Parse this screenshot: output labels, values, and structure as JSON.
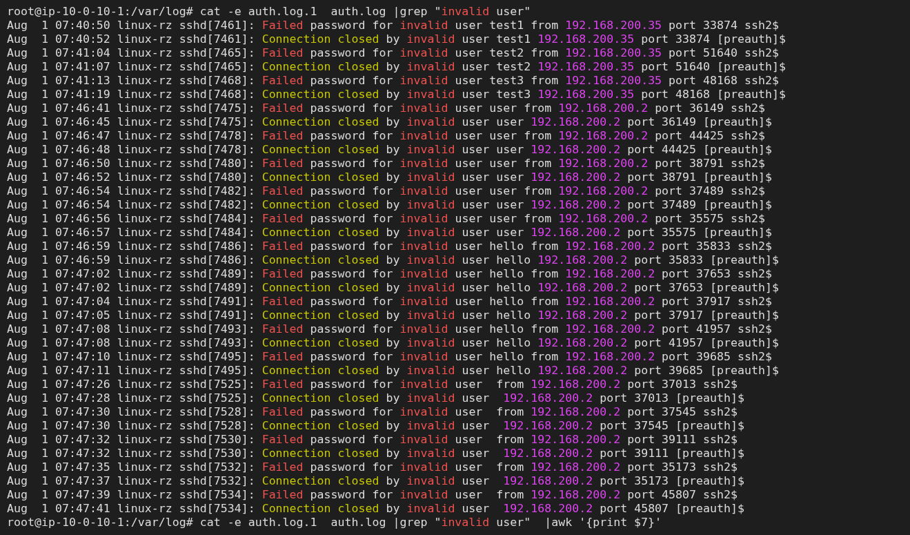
{
  "terminal": {
    "lines": [
      {
        "segments": [
          {
            "text": "root@ip-10-0-10-1:/var/log# cat -e auth.log.1  auth.log |grep \"",
            "kind": "plain"
          },
          {
            "text": "invalid",
            "kind": "error"
          },
          {
            "text": " user\"",
            "kind": "plain"
          }
        ]
      },
      {
        "segments": [
          {
            "text": "Aug  1 07:40:50 linux-rz sshd[7461]: ",
            "kind": "plain"
          },
          {
            "text": "Failed",
            "kind": "error"
          },
          {
            "text": " password for ",
            "kind": "plain"
          },
          {
            "text": "invalid",
            "kind": "error"
          },
          {
            "text": " user test1 from ",
            "kind": "plain"
          },
          {
            "text": "192.168.200.35",
            "kind": "ip"
          },
          {
            "text": " port 33874 ssh2$",
            "kind": "plain"
          }
        ]
      },
      {
        "segments": [
          {
            "text": "Aug  1 07:40:52 linux-rz sshd[7461]: ",
            "kind": "plain"
          },
          {
            "text": "Connection closed",
            "kind": "ok"
          },
          {
            "text": " by ",
            "kind": "plain"
          },
          {
            "text": "invalid",
            "kind": "error"
          },
          {
            "text": " user test1 ",
            "kind": "plain"
          },
          {
            "text": "192.168.200.35",
            "kind": "ip"
          },
          {
            "text": " port 33874 [preauth]$",
            "kind": "plain"
          }
        ]
      },
      {
        "segments": [
          {
            "text": "Aug  1 07:41:04 linux-rz sshd[7465]: ",
            "kind": "plain"
          },
          {
            "text": "Failed",
            "kind": "error"
          },
          {
            "text": " password for ",
            "kind": "plain"
          },
          {
            "text": "invalid",
            "kind": "error"
          },
          {
            "text": " user test2 from ",
            "kind": "plain"
          },
          {
            "text": "192.168.200.35",
            "kind": "ip"
          },
          {
            "text": " port 51640 ssh2$",
            "kind": "plain"
          }
        ]
      },
      {
        "segments": [
          {
            "text": "Aug  1 07:41:07 linux-rz sshd[7465]: ",
            "kind": "plain"
          },
          {
            "text": "Connection closed",
            "kind": "ok"
          },
          {
            "text": " by ",
            "kind": "plain"
          },
          {
            "text": "invalid",
            "kind": "error"
          },
          {
            "text": " user test2 ",
            "kind": "plain"
          },
          {
            "text": "192.168.200.35",
            "kind": "ip"
          },
          {
            "text": " port 51640 [preauth]$",
            "kind": "plain"
          }
        ]
      },
      {
        "segments": [
          {
            "text": "Aug  1 07:41:13 linux-rz sshd[7468]: ",
            "kind": "plain"
          },
          {
            "text": "Failed",
            "kind": "error"
          },
          {
            "text": " password for ",
            "kind": "plain"
          },
          {
            "text": "invalid",
            "kind": "error"
          },
          {
            "text": " user test3 from ",
            "kind": "plain"
          },
          {
            "text": "192.168.200.35",
            "kind": "ip"
          },
          {
            "text": " port 48168 ssh2$",
            "kind": "plain"
          }
        ]
      },
      {
        "segments": [
          {
            "text": "Aug  1 07:41:19 linux-rz sshd[7468]: ",
            "kind": "plain"
          },
          {
            "text": "Connection closed",
            "kind": "ok"
          },
          {
            "text": " by ",
            "kind": "plain"
          },
          {
            "text": "invalid",
            "kind": "error"
          },
          {
            "text": " user test3 ",
            "kind": "plain"
          },
          {
            "text": "192.168.200.35",
            "kind": "ip"
          },
          {
            "text": " port 48168 [preauth]$",
            "kind": "plain"
          }
        ]
      },
      {
        "segments": [
          {
            "text": "Aug  1 07:46:41 linux-rz sshd[7475]: ",
            "kind": "plain"
          },
          {
            "text": "Failed",
            "kind": "error"
          },
          {
            "text": " password for ",
            "kind": "plain"
          },
          {
            "text": "invalid",
            "kind": "error"
          },
          {
            "text": " user user from ",
            "kind": "plain"
          },
          {
            "text": "192.168.200.2",
            "kind": "ip"
          },
          {
            "text": " port 36149 ssh2$",
            "kind": "plain"
          }
        ]
      },
      {
        "segments": [
          {
            "text": "Aug  1 07:46:45 linux-rz sshd[7475]: ",
            "kind": "plain"
          },
          {
            "text": "Connection closed",
            "kind": "ok"
          },
          {
            "text": " by ",
            "kind": "plain"
          },
          {
            "text": "invalid",
            "kind": "error"
          },
          {
            "text": " user user ",
            "kind": "plain"
          },
          {
            "text": "192.168.200.2",
            "kind": "ip"
          },
          {
            "text": " port 36149 [preauth]$",
            "kind": "plain"
          }
        ]
      },
      {
        "segments": [
          {
            "text": "Aug  1 07:46:47 linux-rz sshd[7478]: ",
            "kind": "plain"
          },
          {
            "text": "Failed",
            "kind": "error"
          },
          {
            "text": " password for ",
            "kind": "plain"
          },
          {
            "text": "invalid",
            "kind": "error"
          },
          {
            "text": " user user from ",
            "kind": "plain"
          },
          {
            "text": "192.168.200.2",
            "kind": "ip"
          },
          {
            "text": " port 44425 ssh2$",
            "kind": "plain"
          }
        ]
      },
      {
        "segments": [
          {
            "text": "Aug  1 07:46:48 linux-rz sshd[7478]: ",
            "kind": "plain"
          },
          {
            "text": "Connection closed",
            "kind": "ok"
          },
          {
            "text": " by ",
            "kind": "plain"
          },
          {
            "text": "invalid",
            "kind": "error"
          },
          {
            "text": " user user ",
            "kind": "plain"
          },
          {
            "text": "192.168.200.2",
            "kind": "ip"
          },
          {
            "text": " port 44425 [preauth]$",
            "kind": "plain"
          }
        ]
      },
      {
        "segments": [
          {
            "text": "Aug  1 07:46:50 linux-rz sshd[7480]: ",
            "kind": "plain"
          },
          {
            "text": "Failed",
            "kind": "error"
          },
          {
            "text": " password for ",
            "kind": "plain"
          },
          {
            "text": "invalid",
            "kind": "error"
          },
          {
            "text": " user user from ",
            "kind": "plain"
          },
          {
            "text": "192.168.200.2",
            "kind": "ip"
          },
          {
            "text": " port 38791 ssh2$",
            "kind": "plain"
          }
        ]
      },
      {
        "segments": [
          {
            "text": "Aug  1 07:46:52 linux-rz sshd[7480]: ",
            "kind": "plain"
          },
          {
            "text": "Connection closed",
            "kind": "ok"
          },
          {
            "text": " by ",
            "kind": "plain"
          },
          {
            "text": "invalid",
            "kind": "error"
          },
          {
            "text": " user user ",
            "kind": "plain"
          },
          {
            "text": "192.168.200.2",
            "kind": "ip"
          },
          {
            "text": " port 38791 [preauth]$",
            "kind": "plain"
          }
        ]
      },
      {
        "segments": [
          {
            "text": "Aug  1 07:46:54 linux-rz sshd[7482]: ",
            "kind": "plain"
          },
          {
            "text": "Failed",
            "kind": "error"
          },
          {
            "text": " password for ",
            "kind": "plain"
          },
          {
            "text": "invalid",
            "kind": "error"
          },
          {
            "text": " user user from ",
            "kind": "plain"
          },
          {
            "text": "192.168.200.2",
            "kind": "ip"
          },
          {
            "text": " port 37489 ssh2$",
            "kind": "plain"
          }
        ]
      },
      {
        "segments": [
          {
            "text": "Aug  1 07:46:54 linux-rz sshd[7482]: ",
            "kind": "plain"
          },
          {
            "text": "Connection closed",
            "kind": "ok"
          },
          {
            "text": " by ",
            "kind": "plain"
          },
          {
            "text": "invalid",
            "kind": "error"
          },
          {
            "text": " user user ",
            "kind": "plain"
          },
          {
            "text": "192.168.200.2",
            "kind": "ip"
          },
          {
            "text": " port 37489 [preauth]$",
            "kind": "plain"
          }
        ]
      },
      {
        "segments": [
          {
            "text": "Aug  1 07:46:56 linux-rz sshd[7484]: ",
            "kind": "plain"
          },
          {
            "text": "Failed",
            "kind": "error"
          },
          {
            "text": " password for ",
            "kind": "plain"
          },
          {
            "text": "invalid",
            "kind": "error"
          },
          {
            "text": " user user from ",
            "kind": "plain"
          },
          {
            "text": "192.168.200.2",
            "kind": "ip"
          },
          {
            "text": " port 35575 ssh2$",
            "kind": "plain"
          }
        ]
      },
      {
        "segments": [
          {
            "text": "Aug  1 07:46:57 linux-rz sshd[7484]: ",
            "kind": "plain"
          },
          {
            "text": "Connection closed",
            "kind": "ok"
          },
          {
            "text": " by ",
            "kind": "plain"
          },
          {
            "text": "invalid",
            "kind": "error"
          },
          {
            "text": " user user ",
            "kind": "plain"
          },
          {
            "text": "192.168.200.2",
            "kind": "ip"
          },
          {
            "text": " port 35575 [preauth]$",
            "kind": "plain"
          }
        ]
      },
      {
        "segments": [
          {
            "text": "Aug  1 07:46:59 linux-rz sshd[7486]: ",
            "kind": "plain"
          },
          {
            "text": "Failed",
            "kind": "error"
          },
          {
            "text": " password for ",
            "kind": "plain"
          },
          {
            "text": "invalid",
            "kind": "error"
          },
          {
            "text": " user hello from ",
            "kind": "plain"
          },
          {
            "text": "192.168.200.2",
            "kind": "ip"
          },
          {
            "text": " port 35833 ssh2$",
            "kind": "plain"
          }
        ]
      },
      {
        "segments": [
          {
            "text": "Aug  1 07:46:59 linux-rz sshd[7486]: ",
            "kind": "plain"
          },
          {
            "text": "Connection closed",
            "kind": "ok"
          },
          {
            "text": " by ",
            "kind": "plain"
          },
          {
            "text": "invalid",
            "kind": "error"
          },
          {
            "text": " user hello ",
            "kind": "plain"
          },
          {
            "text": "192.168.200.2",
            "kind": "ip"
          },
          {
            "text": " port 35833 [preauth]$",
            "kind": "plain"
          }
        ]
      },
      {
        "segments": [
          {
            "text": "Aug  1 07:47:02 linux-rz sshd[7489]: ",
            "kind": "plain"
          },
          {
            "text": "Failed",
            "kind": "error"
          },
          {
            "text": " password for ",
            "kind": "plain"
          },
          {
            "text": "invalid",
            "kind": "error"
          },
          {
            "text": " user hello from ",
            "kind": "plain"
          },
          {
            "text": "192.168.200.2",
            "kind": "ip"
          },
          {
            "text": " port 37653 ssh2$",
            "kind": "plain"
          }
        ]
      },
      {
        "segments": [
          {
            "text": "Aug  1 07:47:02 linux-rz sshd[7489]: ",
            "kind": "plain"
          },
          {
            "text": "Connection closed",
            "kind": "ok"
          },
          {
            "text": " by ",
            "kind": "plain"
          },
          {
            "text": "invalid",
            "kind": "error"
          },
          {
            "text": " user hello ",
            "kind": "plain"
          },
          {
            "text": "192.168.200.2",
            "kind": "ip"
          },
          {
            "text": " port 37653 [preauth]$",
            "kind": "plain"
          }
        ]
      },
      {
        "segments": [
          {
            "text": "Aug  1 07:47:04 linux-rz sshd[7491]: ",
            "kind": "plain"
          },
          {
            "text": "Failed",
            "kind": "error"
          },
          {
            "text": " password for ",
            "kind": "plain"
          },
          {
            "text": "invalid",
            "kind": "error"
          },
          {
            "text": " user hello from ",
            "kind": "plain"
          },
          {
            "text": "192.168.200.2",
            "kind": "ip"
          },
          {
            "text": " port 37917 ssh2$",
            "kind": "plain"
          }
        ]
      },
      {
        "segments": [
          {
            "text": "Aug  1 07:47:05 linux-rz sshd[7491]: ",
            "kind": "plain"
          },
          {
            "text": "Connection closed",
            "kind": "ok"
          },
          {
            "text": " by ",
            "kind": "plain"
          },
          {
            "text": "invalid",
            "kind": "error"
          },
          {
            "text": " user hello ",
            "kind": "plain"
          },
          {
            "text": "192.168.200.2",
            "kind": "ip"
          },
          {
            "text": " port 37917 [preauth]$",
            "kind": "plain"
          }
        ]
      },
      {
        "segments": [
          {
            "text": "Aug  1 07:47:08 linux-rz sshd[7493]: ",
            "kind": "plain"
          },
          {
            "text": "Failed",
            "kind": "error"
          },
          {
            "text": " password for ",
            "kind": "plain"
          },
          {
            "text": "invalid",
            "kind": "error"
          },
          {
            "text": " user hello from ",
            "kind": "plain"
          },
          {
            "text": "192.168.200.2",
            "kind": "ip"
          },
          {
            "text": " port 41957 ssh2$",
            "kind": "plain"
          }
        ]
      },
      {
        "segments": [
          {
            "text": "Aug  1 07:47:08 linux-rz sshd[7493]: ",
            "kind": "plain"
          },
          {
            "text": "Connection closed",
            "kind": "ok"
          },
          {
            "text": " by ",
            "kind": "plain"
          },
          {
            "text": "invalid",
            "kind": "error"
          },
          {
            "text": " user hello ",
            "kind": "plain"
          },
          {
            "text": "192.168.200.2",
            "kind": "ip"
          },
          {
            "text": " port 41957 [preauth]$",
            "kind": "plain"
          }
        ]
      },
      {
        "segments": [
          {
            "text": "Aug  1 07:47:10 linux-rz sshd[7495]: ",
            "kind": "plain"
          },
          {
            "text": "Failed",
            "kind": "error"
          },
          {
            "text": " password for ",
            "kind": "plain"
          },
          {
            "text": "invalid",
            "kind": "error"
          },
          {
            "text": " user hello from ",
            "kind": "plain"
          },
          {
            "text": "192.168.200.2",
            "kind": "ip"
          },
          {
            "text": " port 39685 ssh2$",
            "kind": "plain"
          }
        ]
      },
      {
        "segments": [
          {
            "text": "Aug  1 07:47:11 linux-rz sshd[7495]: ",
            "kind": "plain"
          },
          {
            "text": "Connection closed",
            "kind": "ok"
          },
          {
            "text": " by ",
            "kind": "plain"
          },
          {
            "text": "invalid",
            "kind": "error"
          },
          {
            "text": " user hello ",
            "kind": "plain"
          },
          {
            "text": "192.168.200.2",
            "kind": "ip"
          },
          {
            "text": " port 39685 [preauth]$",
            "kind": "plain"
          }
        ]
      },
      {
        "segments": [
          {
            "text": "Aug  1 07:47:26 linux-rz sshd[7525]: ",
            "kind": "plain"
          },
          {
            "text": "Failed",
            "kind": "error"
          },
          {
            "text": " password for ",
            "kind": "plain"
          },
          {
            "text": "invalid",
            "kind": "error"
          },
          {
            "text": " user  from ",
            "kind": "plain"
          },
          {
            "text": "192.168.200.2",
            "kind": "ip"
          },
          {
            "text": " port 37013 ssh2$",
            "kind": "plain"
          }
        ]
      },
      {
        "segments": [
          {
            "text": "Aug  1 07:47:28 linux-rz sshd[7525]: ",
            "kind": "plain"
          },
          {
            "text": "Connection closed",
            "kind": "ok"
          },
          {
            "text": " by ",
            "kind": "plain"
          },
          {
            "text": "invalid",
            "kind": "error"
          },
          {
            "text": " user  ",
            "kind": "plain"
          },
          {
            "text": "192.168.200.2",
            "kind": "ip"
          },
          {
            "text": " port 37013 [preauth]$",
            "kind": "plain"
          }
        ]
      },
      {
        "segments": [
          {
            "text": "Aug  1 07:47:30 linux-rz sshd[7528]: ",
            "kind": "plain"
          },
          {
            "text": "Failed",
            "kind": "error"
          },
          {
            "text": " password for ",
            "kind": "plain"
          },
          {
            "text": "invalid",
            "kind": "error"
          },
          {
            "text": " user  from ",
            "kind": "plain"
          },
          {
            "text": "192.168.200.2",
            "kind": "ip"
          },
          {
            "text": " port 37545 ssh2$",
            "kind": "plain"
          }
        ]
      },
      {
        "segments": [
          {
            "text": "Aug  1 07:47:30 linux-rz sshd[7528]: ",
            "kind": "plain"
          },
          {
            "text": "Connection closed",
            "kind": "ok"
          },
          {
            "text": " by ",
            "kind": "plain"
          },
          {
            "text": "invalid",
            "kind": "error"
          },
          {
            "text": " user  ",
            "kind": "plain"
          },
          {
            "text": "192.168.200.2",
            "kind": "ip"
          },
          {
            "text": " port 37545 [preauth]$",
            "kind": "plain"
          }
        ]
      },
      {
        "segments": [
          {
            "text": "Aug  1 07:47:32 linux-rz sshd[7530]: ",
            "kind": "plain"
          },
          {
            "text": "Failed",
            "kind": "error"
          },
          {
            "text": " password for ",
            "kind": "plain"
          },
          {
            "text": "invalid",
            "kind": "error"
          },
          {
            "text": " user  from ",
            "kind": "plain"
          },
          {
            "text": "192.168.200.2",
            "kind": "ip"
          },
          {
            "text": " port 39111 ssh2$",
            "kind": "plain"
          }
        ]
      },
      {
        "segments": [
          {
            "text": "Aug  1 07:47:32 linux-rz sshd[7530]: ",
            "kind": "plain"
          },
          {
            "text": "Connection closed",
            "kind": "ok"
          },
          {
            "text": " by ",
            "kind": "plain"
          },
          {
            "text": "invalid",
            "kind": "error"
          },
          {
            "text": " user  ",
            "kind": "plain"
          },
          {
            "text": "192.168.200.2",
            "kind": "ip"
          },
          {
            "text": " port 39111 [preauth]$",
            "kind": "plain"
          }
        ]
      },
      {
        "segments": [
          {
            "text": "Aug  1 07:47:35 linux-rz sshd[7532]: ",
            "kind": "plain"
          },
          {
            "text": "Failed",
            "kind": "error"
          },
          {
            "text": " password for ",
            "kind": "plain"
          },
          {
            "text": "invalid",
            "kind": "error"
          },
          {
            "text": " user  from ",
            "kind": "plain"
          },
          {
            "text": "192.168.200.2",
            "kind": "ip"
          },
          {
            "text": " port 35173 ssh2$",
            "kind": "plain"
          }
        ]
      },
      {
        "segments": [
          {
            "text": "Aug  1 07:47:37 linux-rz sshd[7532]: ",
            "kind": "plain"
          },
          {
            "text": "Connection closed",
            "kind": "ok"
          },
          {
            "text": " by ",
            "kind": "plain"
          },
          {
            "text": "invalid",
            "kind": "error"
          },
          {
            "text": " user  ",
            "kind": "plain"
          },
          {
            "text": "192.168.200.2",
            "kind": "ip"
          },
          {
            "text": " port 35173 [preauth]$",
            "kind": "plain"
          }
        ]
      },
      {
        "segments": [
          {
            "text": "Aug  1 07:47:39 linux-rz sshd[7534]: ",
            "kind": "plain"
          },
          {
            "text": "Failed",
            "kind": "error"
          },
          {
            "text": " password for ",
            "kind": "plain"
          },
          {
            "text": "invalid",
            "kind": "error"
          },
          {
            "text": " user  from ",
            "kind": "plain"
          },
          {
            "text": "192.168.200.2",
            "kind": "ip"
          },
          {
            "text": " port 45807 ssh2$",
            "kind": "plain"
          }
        ]
      },
      {
        "segments": [
          {
            "text": "Aug  1 07:47:41 linux-rz sshd[7534]: ",
            "kind": "plain"
          },
          {
            "text": "Connection closed",
            "kind": "ok"
          },
          {
            "text": " by ",
            "kind": "plain"
          },
          {
            "text": "invalid",
            "kind": "error"
          },
          {
            "text": " user  ",
            "kind": "plain"
          },
          {
            "text": "192.168.200.2",
            "kind": "ip"
          },
          {
            "text": " port 45807 [preauth]$",
            "kind": "plain"
          }
        ]
      },
      {
        "segments": [
          {
            "text": "root@ip-10-0-10-1:/var/log# cat -e auth.log.1  auth.log |grep \"",
            "kind": "plain"
          },
          {
            "text": "invalid",
            "kind": "error"
          },
          {
            "text": " user\"  |awk '{print $7}'",
            "kind": "plain"
          }
        ]
      }
    ]
  }
}
